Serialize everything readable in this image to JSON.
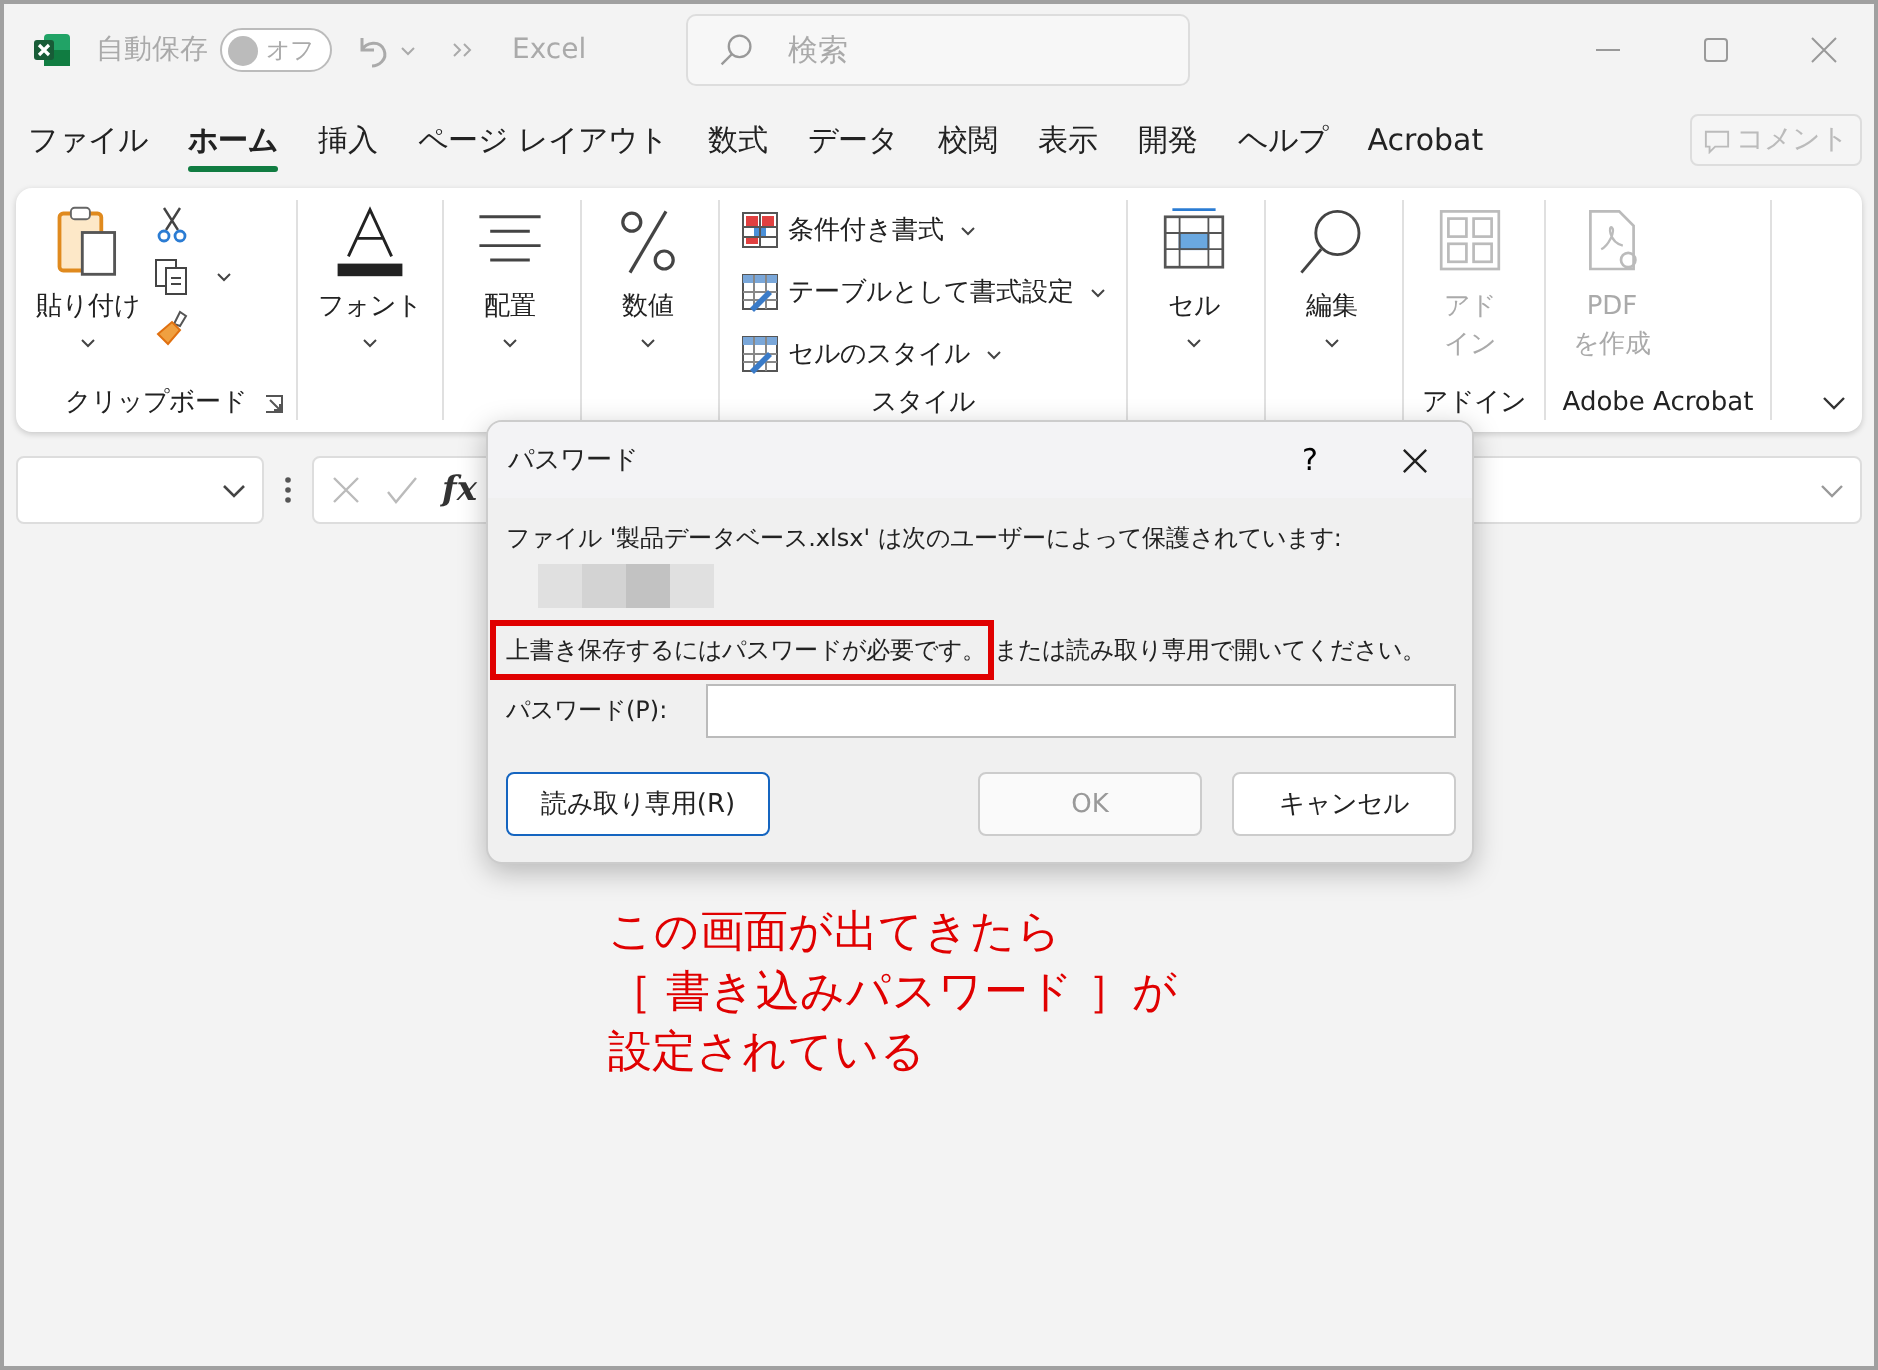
{
  "title_bar": {
    "autosave_label": "自動保存",
    "autosave": {
      "on": false,
      "label": "オフ"
    },
    "app_name": "Excel",
    "search": {
      "placeholder": "検索"
    }
  },
  "menu_tabs": [
    {
      "label": "ファイル",
      "selected": false
    },
    {
      "label": "ホーム",
      "selected": true
    },
    {
      "label": "挿入",
      "selected": false
    },
    {
      "label": "ページ レイアウト",
      "selected": false
    },
    {
      "label": "数式",
      "selected": false
    },
    {
      "label": "データ",
      "selected": false
    },
    {
      "label": "校閲",
      "selected": false
    },
    {
      "label": "表示",
      "selected": false
    },
    {
      "label": "開発",
      "selected": false
    },
    {
      "label": "ヘルプ",
      "selected": false
    },
    {
      "label": "Acrobat",
      "selected": false
    }
  ],
  "comment_button": {
    "label": "コメント",
    "disabled": true
  },
  "ribbon": [
    {
      "label": "クリップボード",
      "launcher": true,
      "items": [
        {
          "kind": "paste",
          "label": "貼り付け",
          "disabled": false
        }
      ]
    },
    {
      "items": [
        {
          "kind": "font",
          "label": "フォント",
          "disabled": false
        }
      ]
    },
    {
      "items": [
        {
          "kind": "align",
          "label": "配置",
          "disabled": false
        }
      ]
    },
    {
      "items": [
        {
          "kind": "number",
          "label": "数値",
          "disabled": false
        }
      ]
    },
    {
      "label": "スタイル",
      "items": [
        {
          "kind": "cond-format",
          "label": "条件付き書式",
          "disabled": false
        },
        {
          "kind": "table-format",
          "label": "テーブルとして書式設定",
          "disabled": false
        },
        {
          "kind": "cell-style",
          "label": "セルのスタイル",
          "disabled": false
        }
      ]
    },
    {
      "items": [
        {
          "kind": "cells",
          "label": "セル",
          "disabled": false
        }
      ]
    },
    {
      "items": [
        {
          "kind": "find",
          "label": "編集",
          "disabled": false
        }
      ]
    },
    {
      "label": "アドイン",
      "items": [
        {
          "kind": "addins",
          "label": "アドイン",
          "disabled": true
        }
      ]
    },
    {
      "label": "Adobe Acrobat",
      "items": [
        {
          "kind": "pdf",
          "label": "PDF\nを作成",
          "disabled": true
        }
      ]
    }
  ],
  "formula_bar": {
    "fx": "fx"
  },
  "dialog": {
    "title": "パスワード",
    "help": "?",
    "message": "ファイル '製品データベース.xlsx' は次のユーザーによって保護されています:",
    "notice_highlighted": "上書き保存するにはパスワードが必要です。",
    "notice_rest": "または読み取り専用で開いてください。",
    "password_label": "パスワード(P):",
    "buttons": [
      {
        "label": "読み取り専用(R)",
        "focused": true,
        "disabled": false
      },
      {
        "label": "OK",
        "focused": false,
        "disabled": true
      },
      {
        "label": "キャンセル",
        "focused": false,
        "disabled": false
      }
    ]
  },
  "annotation": [
    "この画面が出てきたら",
    "［ 書き込みパスワード ］が",
    "設定されている"
  ]
}
